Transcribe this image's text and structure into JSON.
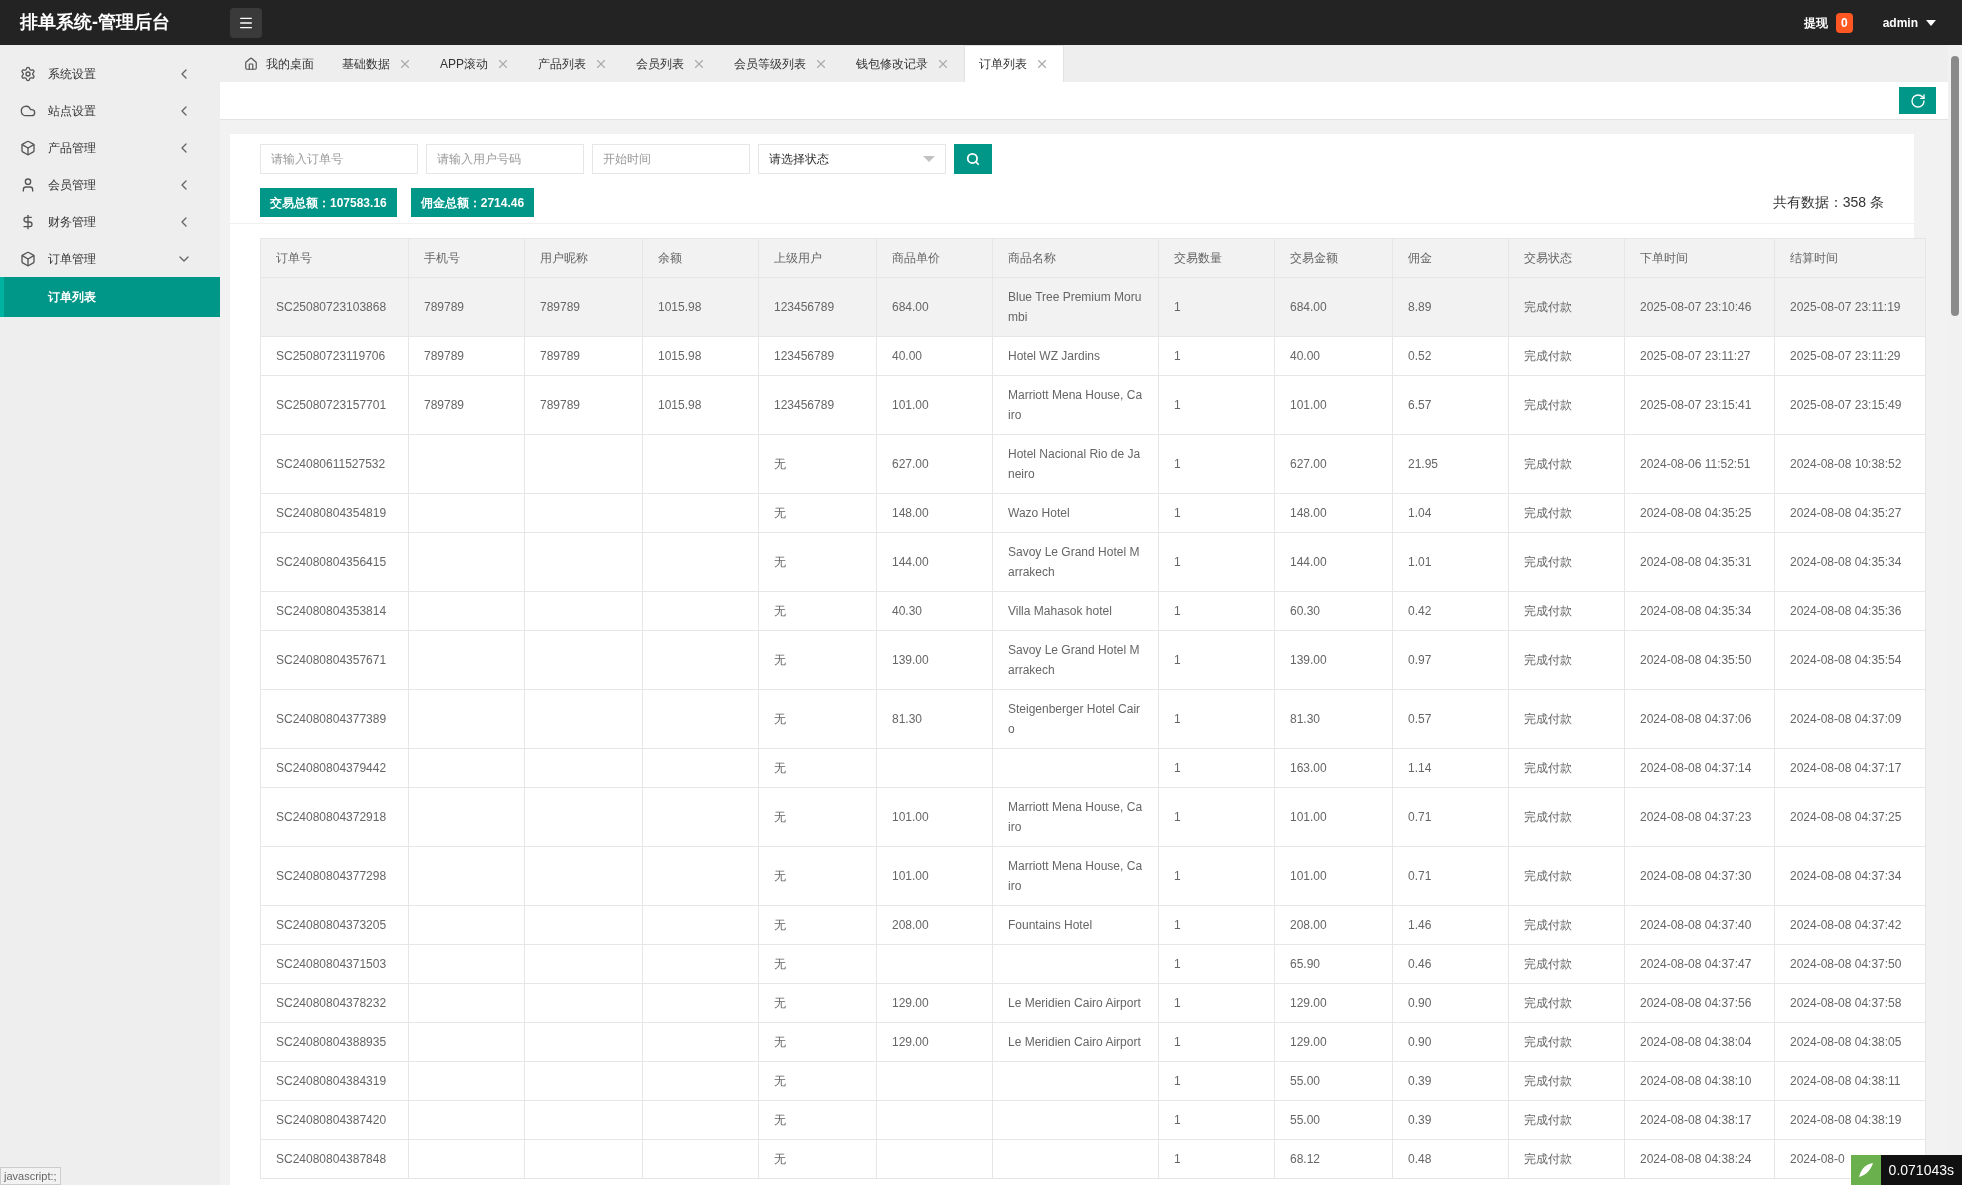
{
  "header": {
    "title": "排单系统-管理后台",
    "withdraw_label": "提现",
    "withdraw_count": "0",
    "user": "admin"
  },
  "sidebar": {
    "items": [
      {
        "label": "系统设置",
        "expanded": false
      },
      {
        "label": "站点设置",
        "expanded": false
      },
      {
        "label": "产品管理",
        "expanded": false
      },
      {
        "label": "会员管理",
        "expanded": false
      },
      {
        "label": "财务管理",
        "expanded": false
      },
      {
        "label": "订单管理",
        "expanded": true,
        "children": [
          {
            "label": "订单列表",
            "selected": true
          }
        ]
      }
    ]
  },
  "tabs": [
    {
      "label": "我的桌面",
      "kind": "home",
      "selected": false
    },
    {
      "label": "基础数据",
      "kind": "closable",
      "selected": false
    },
    {
      "label": "APP滚动",
      "kind": "closable",
      "selected": false
    },
    {
      "label": "产品列表",
      "kind": "closable",
      "selected": false
    },
    {
      "label": "会员列表",
      "kind": "closable",
      "selected": false
    },
    {
      "label": "会员等级列表",
      "kind": "closable",
      "selected": false
    },
    {
      "label": "钱包修改记录",
      "kind": "closable",
      "selected": false
    },
    {
      "label": "订单列表",
      "kind": "closable",
      "selected": true
    }
  ],
  "filters": {
    "order_placeholder": "请输入订单号",
    "user_placeholder": "请输入用户号码",
    "time_placeholder": "开始时间",
    "status_value": "请选择状态"
  },
  "totals": [
    "交易总额：107583.16",
    "佣金总额：2714.46"
  ],
  "record_count": "共有数据：358 条",
  "table": {
    "columns": [
      "订单号",
      "手机号",
      "用户昵称",
      "余额",
      "上级用户",
      "商品单价",
      "商品名称",
      "交易数量",
      "交易金额",
      "佣金",
      "交易状态",
      "下单时间",
      "结算时间"
    ],
    "rows": [
      {
        "highlighted": true,
        "cells": [
          "SC25080723103868",
          "789789",
          "789789",
          "1015.98",
          "123456789",
          "684.00",
          "Blue Tree Premium Morumbi",
          "1",
          "684.00",
          "8.89",
          "完成付款",
          "2025-08-07 23:10:46",
          "2025-08-07 23:11:19"
        ]
      },
      {
        "highlighted": false,
        "cells": [
          "SC25080723119706",
          "789789",
          "789789",
          "1015.98",
          "123456789",
          "40.00",
          "Hotel WZ Jardins",
          "1",
          "40.00",
          "0.52",
          "完成付款",
          "2025-08-07 23:11:27",
          "2025-08-07 23:11:29"
        ]
      },
      {
        "highlighted": false,
        "cells": [
          "SC25080723157701",
          "789789",
          "789789",
          "1015.98",
          "123456789",
          "101.00",
          "Marriott Mena House, Cairo",
          "1",
          "101.00",
          "6.57",
          "完成付款",
          "2025-08-07 23:15:41",
          "2025-08-07 23:15:49"
        ]
      },
      {
        "highlighted": false,
        "cells": [
          "SC24080611527532",
          "",
          "",
          "",
          "无",
          "627.00",
          "Hotel Nacional Rio de Janeiro",
          "1",
          "627.00",
          "21.95",
          "完成付款",
          "2024-08-06 11:52:51",
          "2024-08-08 10:38:52"
        ]
      },
      {
        "highlighted": false,
        "cells": [
          "SC24080804354819",
          "",
          "",
          "",
          "无",
          "148.00",
          "Wazo Hotel",
          "1",
          "148.00",
          "1.04",
          "完成付款",
          "2024-08-08 04:35:25",
          "2024-08-08 04:35:27"
        ]
      },
      {
        "highlighted": false,
        "cells": [
          "SC24080804356415",
          "",
          "",
          "",
          "无",
          "144.00",
          "Savoy Le Grand Hotel Marrakech",
          "1",
          "144.00",
          "1.01",
          "完成付款",
          "2024-08-08 04:35:31",
          "2024-08-08 04:35:34"
        ]
      },
      {
        "highlighted": false,
        "cells": [
          "SC24080804353814",
          "",
          "",
          "",
          "无",
          "40.30",
          "Villa Mahasok hotel",
          "1",
          "60.30",
          "0.42",
          "完成付款",
          "2024-08-08 04:35:34",
          "2024-08-08 04:35:36"
        ]
      },
      {
        "highlighted": false,
        "cells": [
          "SC24080804357671",
          "",
          "",
          "",
          "无",
          "139.00",
          "Savoy Le Grand Hotel Marrakech",
          "1",
          "139.00",
          "0.97",
          "完成付款",
          "2024-08-08 04:35:50",
          "2024-08-08 04:35:54"
        ]
      },
      {
        "highlighted": false,
        "cells": [
          "SC24080804377389",
          "",
          "",
          "",
          "无",
          "81.30",
          "Steigenberger Hotel Cairo",
          "1",
          "81.30",
          "0.57",
          "完成付款",
          "2024-08-08 04:37:06",
          "2024-08-08 04:37:09"
        ]
      },
      {
        "highlighted": false,
        "cells": [
          "SC24080804379442",
          "",
          "",
          "",
          "无",
          "",
          "",
          "1",
          "163.00",
          "1.14",
          "完成付款",
          "2024-08-08 04:37:14",
          "2024-08-08 04:37:17"
        ]
      },
      {
        "highlighted": false,
        "cells": [
          "SC24080804372918",
          "",
          "",
          "",
          "无",
          "101.00",
          "Marriott Mena House, Cairo",
          "1",
          "101.00",
          "0.71",
          "完成付款",
          "2024-08-08 04:37:23",
          "2024-08-08 04:37:25"
        ]
      },
      {
        "highlighted": false,
        "cells": [
          "SC24080804377298",
          "",
          "",
          "",
          "无",
          "101.00",
          "Marriott Mena House, Cairo",
          "1",
          "101.00",
          "0.71",
          "完成付款",
          "2024-08-08 04:37:30",
          "2024-08-08 04:37:34"
        ]
      },
      {
        "highlighted": false,
        "cells": [
          "SC24080804373205",
          "",
          "",
          "",
          "无",
          "208.00",
          "Fountains Hotel",
          "1",
          "208.00",
          "1.46",
          "完成付款",
          "2024-08-08 04:37:40",
          "2024-08-08 04:37:42"
        ]
      },
      {
        "highlighted": false,
        "cells": [
          "SC24080804371503",
          "",
          "",
          "",
          "无",
          "",
          "",
          "1",
          "65.90",
          "0.46",
          "完成付款",
          "2024-08-08 04:37:47",
          "2024-08-08 04:37:50"
        ]
      },
      {
        "highlighted": false,
        "cells": [
          "SC24080804378232",
          "",
          "",
          "",
          "无",
          "129.00",
          "Le Meridien Cairo Airport",
          "1",
          "129.00",
          "0.90",
          "完成付款",
          "2024-08-08 04:37:56",
          "2024-08-08 04:37:58"
        ]
      },
      {
        "highlighted": false,
        "cells": [
          "SC24080804388935",
          "",
          "",
          "",
          "无",
          "129.00",
          "Le Meridien Cairo Airport",
          "1",
          "129.00",
          "0.90",
          "完成付款",
          "2024-08-08 04:38:04",
          "2024-08-08 04:38:05"
        ]
      },
      {
        "highlighted": false,
        "cells": [
          "SC24080804384319",
          "",
          "",
          "",
          "无",
          "",
          "",
          "1",
          "55.00",
          "0.39",
          "完成付款",
          "2024-08-08 04:38:10",
          "2024-08-08 04:38:11"
        ]
      },
      {
        "highlighted": false,
        "cells": [
          "SC24080804387420",
          "",
          "",
          "",
          "无",
          "",
          "",
          "1",
          "55.00",
          "0.39",
          "完成付款",
          "2024-08-08 04:38:17",
          "2024-08-08 04:38:19"
        ]
      },
      {
        "highlighted": false,
        "cells": [
          "SC24080804387848",
          "",
          "",
          "",
          "无",
          "",
          "",
          "1",
          "68.12",
          "0.48",
          "完成付款",
          "2024-08-08 04:38:24",
          "2024-08-0"
        ]
      }
    ]
  },
  "status_text": "javascript:;",
  "timer_badge": "0.071043s"
}
